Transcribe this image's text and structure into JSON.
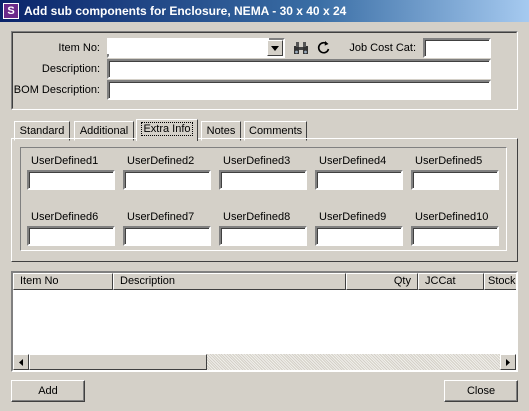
{
  "window": {
    "title": "Add sub components for Enclosure, NEMA - 30 x 40 x 24"
  },
  "form": {
    "item_no_label": "Item No:",
    "item_no_value": "",
    "job_cost_cat_label": "Job Cost Cat:",
    "job_cost_cat_value": "",
    "description_label": "Description:",
    "description_value": "",
    "bom_description_label": "BOM Description:",
    "bom_description_value": ""
  },
  "tabs": [
    {
      "label": "Standard",
      "active": false
    },
    {
      "label": "Additional",
      "active": false
    },
    {
      "label": "Extra Info",
      "active": true
    },
    {
      "label": "Notes",
      "active": false
    },
    {
      "label": "Comments",
      "active": false
    }
  ],
  "user_defined": [
    {
      "label": "UserDefined1",
      "value": ""
    },
    {
      "label": "UserDefined2",
      "value": ""
    },
    {
      "label": "UserDefined3",
      "value": ""
    },
    {
      "label": "UserDefined4",
      "value": ""
    },
    {
      "label": "UserDefined5",
      "value": ""
    },
    {
      "label": "UserDefined6",
      "value": ""
    },
    {
      "label": "UserDefined7",
      "value": ""
    },
    {
      "label": "UserDefined8",
      "value": ""
    },
    {
      "label": "UserDefined9",
      "value": ""
    },
    {
      "label": "UserDefined10",
      "value": ""
    }
  ],
  "grid": {
    "columns": [
      "Item No",
      "Description",
      "Qty",
      "JCCat",
      "Stock"
    ],
    "rows": []
  },
  "buttons": {
    "add_label": "Add",
    "close_label": "Close"
  },
  "icons": {
    "app": "app-icon",
    "search": "binoculars-icon",
    "refresh": "refresh-icon"
  }
}
